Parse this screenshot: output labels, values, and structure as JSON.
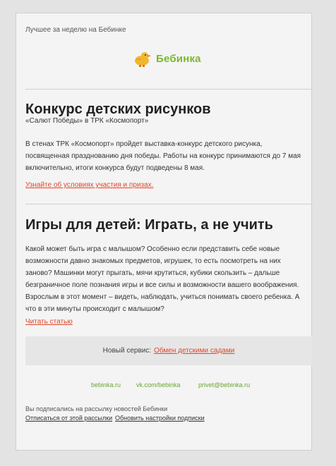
{
  "preheader": "Лучшее за неделю на Бебинке",
  "logo": {
    "text": "Бебинка"
  },
  "article1": {
    "title": "Конкурс детских рисунков",
    "subtitle": "«Салют Победы» в ТРК «Космопорт»",
    "body": "В стенах ТРК «Космопорт» пройдет выставка-конкурс детского рисунка, посвященная празднованию дня победы. Работы на конкурс принимаются до 7 мая включительно, итоги конкурса будут подведены 8 мая.",
    "link": "Узнайте об условиях участия и призах."
  },
  "article2": {
    "title": "Игры для детей: Играть, а не учить",
    "body": "Какой может быть игра с малышом? Особенно если представить себе новые возможности давно знакомых предметов, игрушек, то есть посмотреть на них заново? Машинки могут прыгать, мячи крутиться, кубики скользить – дальше безграничное поле познания игры и все силы и возможности вашего воображения. Взрослым в этот момент – видеть, наблюдать, учиться понимать своего ребенка. А что в эти минуты происходит с малышом?",
    "link": "Читать статью"
  },
  "service": {
    "label": "Новый сервис:",
    "link": "Обмен детскими садами"
  },
  "footer": {
    "links": [
      "bebinka.ru",
      "vk.com/bebinka",
      "privet@bebinka.ru"
    ],
    "notice": "Вы подписались на рассылку новостей Бебинки",
    "unsubscribe": "Отписаться от этой рассылки",
    "settings": "Обновить настройки подписки"
  },
  "colors": {
    "link": "#e0462a",
    "brand": "#7cb82f",
    "duck": "#f2b62e"
  }
}
